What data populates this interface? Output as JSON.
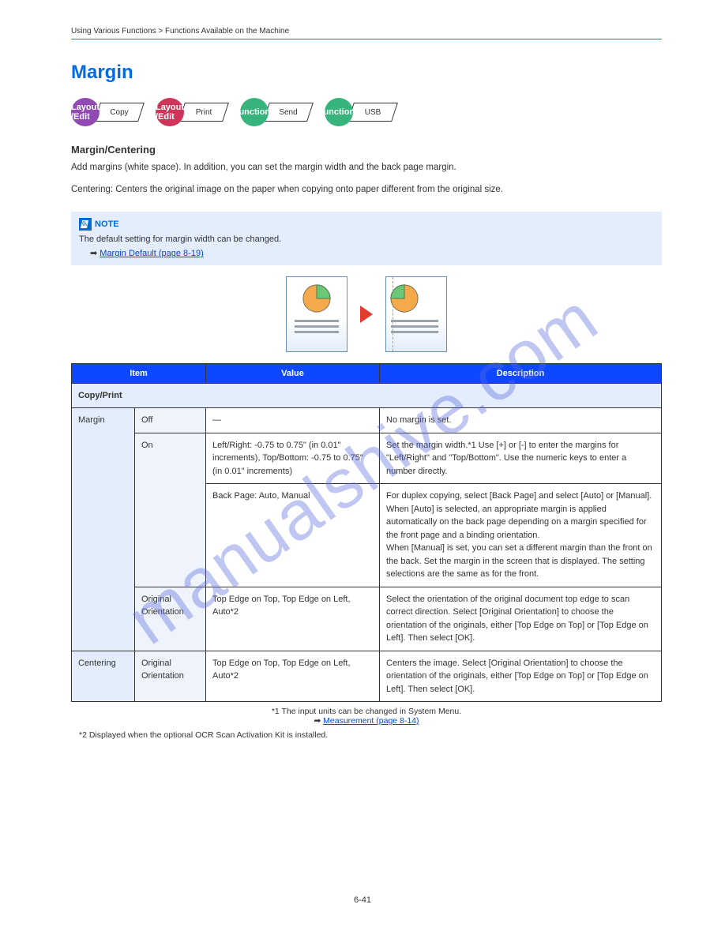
{
  "breadcrumb": "Using Various Functions > Functions Available on the Machine",
  "section_title": "Margin",
  "badges": [
    {
      "color": "c-purple",
      "text": "Layout\n/Edit",
      "label": "Copy"
    },
    {
      "color": "c-red",
      "text": "Layout\n/Edit",
      "label": "Print"
    },
    {
      "color": "c-green",
      "text": "Functions",
      "label": "Send"
    },
    {
      "color": "c-green",
      "text": "Functions",
      "label": "USB"
    }
  ],
  "sub_heading": "Margin/Centering",
  "desc1": "Add margins (white space). In addition, you can set the margin width and the back page margin.",
  "desc2": "Centering: Centers the original image on the paper when copying onto paper different from the original size.",
  "note": {
    "title": "NOTE",
    "body_prefix": "The default setting for margin width can be changed.",
    "link_text": "Margin Default (page 8-19)"
  },
  "table": {
    "headers": [
      "Item",
      "Value",
      "Description"
    ],
    "sub": "Copy/Print",
    "rows": [
      {
        "item": [
          "Margin"
        ],
        "sub": "Off",
        "value": "—",
        "desc": "No margin is set."
      },
      {
        "item": [],
        "sub": "On",
        "value": "Left/Right: -0.75 to 0.75\" (in 0.01\" increments), Top/Bottom: -0.75 to 0.75\" (in 0.01\" increments)",
        "desc": "Set the margin width.*1 Use [+] or [-] to enter the margins for \"Left/Right\" and \"Top/Bottom\". Use the numeric keys to enter a number directly."
      },
      {
        "item": [],
        "sub": "",
        "value": "Back Page: Auto, Manual",
        "desc": "For duplex copying, select [Back Page] and select [Auto] or [Manual].\nWhen [Auto] is selected, an appropriate margin is applied automatically on the back page depending on a margin specified for the front page and a binding orientation.\nWhen [Manual] is set, you can set a different margin than the front on the back. Set the margin in the screen that is displayed. The setting selections are the same as for the front."
      },
      {
        "item": [],
        "sub": "Original Orientation",
        "value": "Top Edge on Top, Top Edge on Left, Auto*2",
        "desc": "Select the orientation of the original document top edge to scan correct direction.\nSelect [Original Orientation] to choose the orientation of the originals, either [Top Edge on Top] or [Top Edge on Left]. Then select [OK]."
      },
      {
        "item": [
          "Centering"
        ],
        "sub": "Original Orientation",
        "value": "Top Edge on Top, Top Edge on Left, Auto*2",
        "desc": "Centers the image.\nSelect [Original Orientation] to choose the orientation of the originals, either [Top Edge on Top] or [Top Edge on Left]. Then select [OK]."
      }
    ],
    "footnotes": [
      "*1 The input units can be changed in System Menu.",
      "*2 Displayed when the optional OCR Scan Activation Kit is installed."
    ],
    "footnote_link": "Measurement (page 8-14)"
  },
  "page_number": "6-41",
  "watermark": "manualshive.com"
}
